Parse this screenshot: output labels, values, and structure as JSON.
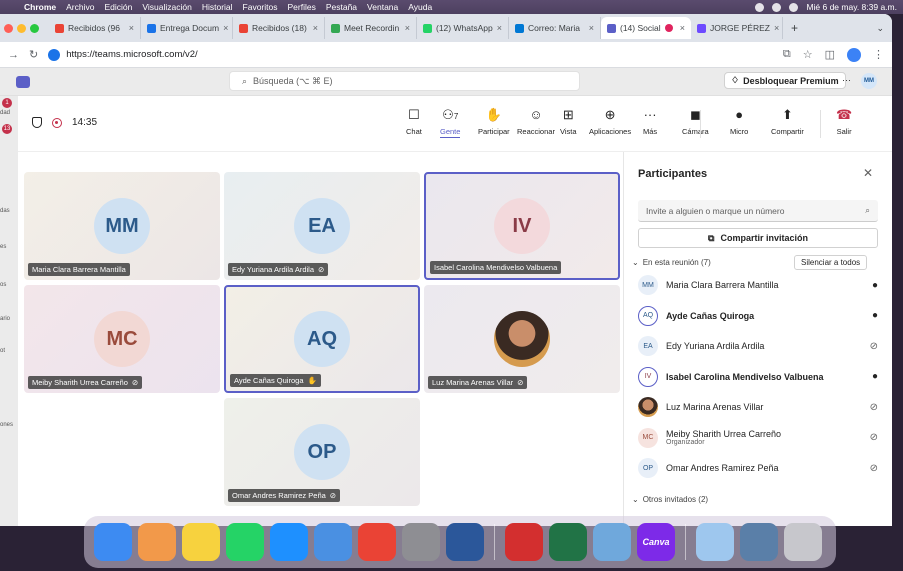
{
  "menubar": {
    "app": "Chrome",
    "items": [
      "Archivo",
      "Edición",
      "Visualización",
      "Historial",
      "Favoritos",
      "Perfiles",
      "Pestaña",
      "Ventana",
      "Ayuda"
    ],
    "clock": "Mié 6 de may.  8:39 a.m."
  },
  "tabs": [
    {
      "label": "Recibidos (96",
      "color": "#ea4335"
    },
    {
      "label": "Entrega Docum",
      "color": "#1a73e8"
    },
    {
      "label": "Recibidos (18)",
      "color": "#ea4335"
    },
    {
      "label": "Meet Recordin",
      "color": "#34a853"
    },
    {
      "label": "(12) WhatsApp",
      "color": "#25d366"
    },
    {
      "label": "Correo: Maria",
      "color": "#0078d4"
    },
    {
      "label": "(14) Social",
      "color": "#5b5fc7",
      "active": true
    },
    {
      "label": "JORGE PÉREZ",
      "color": "#6d4aff"
    }
  ],
  "address": {
    "url": "https://teams.microsoft.com/v2/"
  },
  "teams": {
    "search_placeholder": "Búsqueda (⌥ ⌘ E)",
    "premium": "Desbloquear Premium",
    "user_initials": "MM"
  },
  "rail": {
    "badge1": "1",
    "badge2": "13",
    "labels": [
      "dad",
      "das",
      "es",
      "os",
      "ario",
      "ot",
      "ones"
    ]
  },
  "meeting": {
    "timer": "14:35",
    "toolbar": [
      {
        "label": "Chat",
        "icon": "chat-icon"
      },
      {
        "label": "Gente",
        "icon": "people-icon",
        "count": "7",
        "active": true
      },
      {
        "label": "Participar",
        "icon": "hand-icon"
      },
      {
        "label": "Reaccionar",
        "icon": "emoji-icon"
      },
      {
        "label": "Vista",
        "icon": "grid-icon"
      },
      {
        "label": "Aplicaciones",
        "icon": "apps-icon"
      },
      {
        "label": "Más",
        "icon": "more-icon"
      },
      {
        "label": "Cámara",
        "icon": "camera-off-icon"
      },
      {
        "label": "Micro",
        "icon": "mic-icon"
      },
      {
        "label": "Compartir",
        "icon": "share-icon"
      },
      {
        "label": "Salir",
        "icon": "leave-icon"
      }
    ]
  },
  "tiles": [
    {
      "initials": "MM",
      "name": "Maria Clara Barrera Mantilla",
      "muted": false,
      "hl": false
    },
    {
      "initials": "EA",
      "name": "Edy Yuriana Ardila Ardila",
      "muted": true,
      "hl": false
    },
    {
      "initials": "IV",
      "name": "Isabel Carolina Mendivelso Valbuena",
      "muted": false,
      "hl": true
    },
    {
      "initials": "MC",
      "name": "Meiby Sharith Urrea Carreño",
      "muted": true,
      "hl": false
    },
    {
      "initials": "AQ",
      "name": "Ayde Cañas Quiroga",
      "muted": false,
      "hl": true
    },
    {
      "initials": "",
      "name": "Luz Marina Arenas Villar",
      "muted": true,
      "hl": false
    },
    {
      "initials": "OP",
      "name": "Omar Andres Ramirez Peña",
      "muted": true,
      "hl": false
    }
  ],
  "panel": {
    "title": "Participantes",
    "invite_placeholder": "Invite a alguien o marque un número",
    "share": "Compartir invitación",
    "in_meeting": "En esta reunión (7)",
    "mute_all": "Silenciar a todos",
    "others": "Otros invitados (2)",
    "people": [
      {
        "initials": "MM",
        "name": "Maria Clara Barrera Mantilla",
        "muted": false,
        "bold": false
      },
      {
        "initials": "AQ",
        "name": "Ayde Cañas Quiroga",
        "muted": false,
        "bold": true
      },
      {
        "initials": "EA",
        "name": "Edy Yuriana Ardila Ardila",
        "muted": true,
        "bold": false
      },
      {
        "initials": "IV",
        "name": "Isabel Carolina Mendivelso Valbuena",
        "muted": false,
        "bold": true
      },
      {
        "initials": "",
        "name": "Luz Marina Arenas Villar",
        "muted": true,
        "bold": false
      },
      {
        "initials": "MC",
        "name": "Meiby Sharith Urrea Carreño",
        "sub": "Organizador",
        "muted": true,
        "bold": false
      },
      {
        "initials": "OP",
        "name": "Omar Andres Ramirez Peña",
        "muted": true,
        "bold": false
      }
    ]
  },
  "dock": [
    {
      "name": "finder-icon",
      "color": "#3d8bf2"
    },
    {
      "name": "photos-icon",
      "color": "#f2994a"
    },
    {
      "name": "notes-icon",
      "color": "#f7d23e"
    },
    {
      "name": "whatsapp-icon",
      "color": "#25d366"
    },
    {
      "name": "app-store-icon",
      "color": "#1e90ff"
    },
    {
      "name": "mail-icon",
      "color": "#4a90e2"
    },
    {
      "name": "chrome-icon",
      "color": "#ea4335"
    },
    {
      "name": "settings-icon",
      "color": "#8e8e93"
    },
    {
      "name": "word-icon",
      "color": "#2b579a"
    },
    {
      "name": "acrobat-icon",
      "color": "#d32f2f"
    },
    {
      "name": "excel-icon",
      "color": "#217346"
    },
    {
      "name": "preview-icon",
      "color": "#6fa8dc"
    },
    {
      "name": "canva-icon",
      "color": "#7d2ae8",
      "text": "Canva"
    },
    {
      "name": "folder-icon",
      "color": "#9ec7ee"
    },
    {
      "name": "screenshots-icon",
      "color": "#5a7fa8"
    },
    {
      "name": "trash-icon",
      "color": "#c7c7cc"
    }
  ]
}
